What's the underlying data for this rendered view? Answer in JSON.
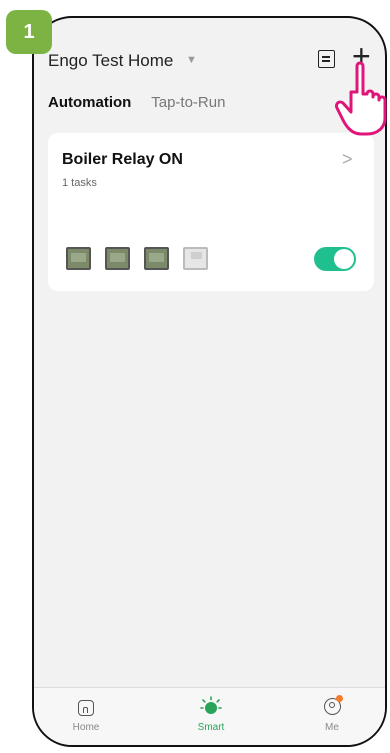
{
  "step": {
    "number": "1",
    "color": "#7cb342"
  },
  "header": {
    "home_name": "Engo Test Home",
    "dropdown_icon": "caret-down-icon",
    "list_icon": "list-icon",
    "add_icon": "plus-icon"
  },
  "tabs": [
    {
      "label": "Automation",
      "active": true
    },
    {
      "label": "Tap-to-Run",
      "active": false
    }
  ],
  "scene_card": {
    "title": "Boiler Relay ON",
    "subtitle": "1 tasks",
    "devices": [
      "thermostat-icon",
      "thermostat-icon",
      "thermostat-icon",
      "thermostat-white-icon"
    ],
    "enabled": true,
    "toggle_color": "#1fbf8f"
  },
  "bottom_nav": [
    {
      "label": "Home",
      "icon": "home-icon",
      "active": false
    },
    {
      "label": "Smart",
      "icon": "smart-icon",
      "active": true,
      "color": "#2aa35a"
    },
    {
      "label": "Me",
      "icon": "profile-icon",
      "active": false,
      "badge_color": "#f57c28"
    }
  ],
  "hint": {
    "icon": "pointer-hand-icon",
    "color": "#e0157a"
  }
}
